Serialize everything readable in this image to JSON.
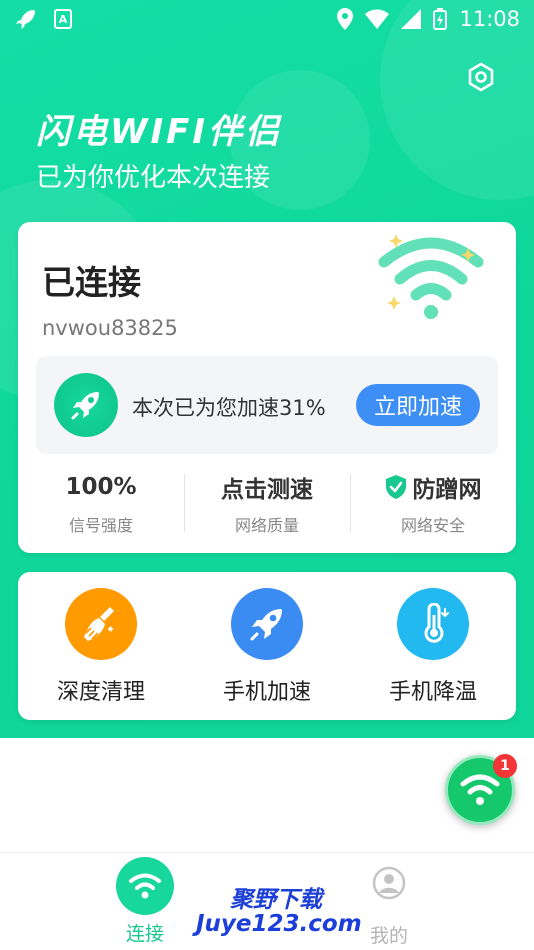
{
  "status_bar": {
    "time": "11:08",
    "notif_letter": "A"
  },
  "header": {
    "title": "闪电WIFI伴侣",
    "subtitle": "已为你优化本次连接"
  },
  "connection": {
    "status": "已连接",
    "ssid": "nvwou83825",
    "boost_text": "本次已为您加速31%",
    "boost_button": "立即加速"
  },
  "stats": [
    {
      "value": "100%",
      "label": "信号强度"
    },
    {
      "value": "点击测速",
      "label": "网络质量"
    },
    {
      "value": "防蹭网",
      "label": "网络安全"
    }
  ],
  "tools": [
    {
      "label": "深度清理",
      "color": "#ff9a00",
      "icon": "broom-icon"
    },
    {
      "label": "手机加速",
      "color": "#3a8cf3",
      "icon": "rocket-icon"
    },
    {
      "label": "手机降温",
      "color": "#22b8f0",
      "icon": "thermometer-icon"
    }
  ],
  "fab": {
    "badge": "1"
  },
  "nav": {
    "connect": "连接",
    "mine": "我的"
  },
  "watermark": {
    "line1": "聚野下载",
    "line2": "Juye123.com"
  },
  "colors": {
    "brand": "#14dea6",
    "accent_blue": "#3d8ff5",
    "nav_active": "#17c98f",
    "badge": "#f33535"
  }
}
